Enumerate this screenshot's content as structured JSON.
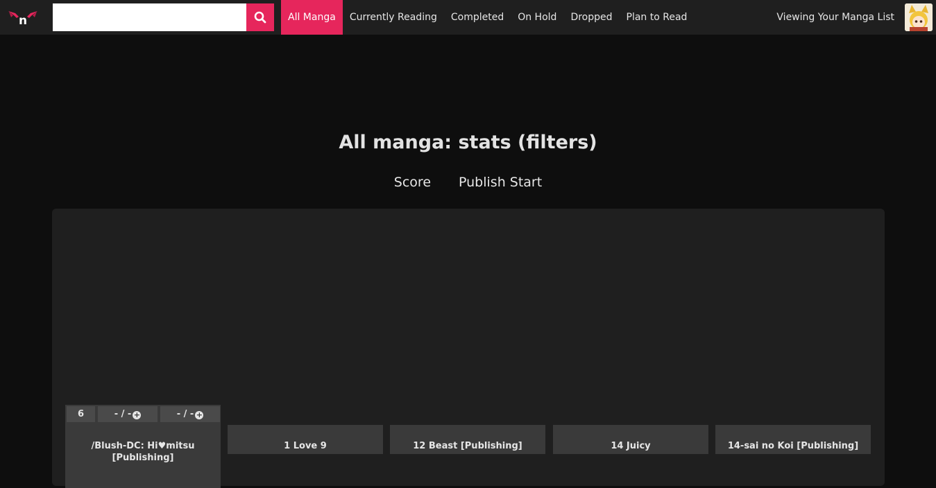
{
  "search": {
    "placeholder": "",
    "value": ""
  },
  "nav": {
    "items": [
      "All Manga",
      "Currently Reading",
      "Completed",
      "On Hold",
      "Dropped",
      "Plan to Read"
    ],
    "active": "All Manga"
  },
  "header": {
    "viewing_label": "Viewing Your Manga List"
  },
  "main": {
    "title": "All manga: stats (filters)",
    "tabs": [
      "Score",
      "Publish Start"
    ]
  },
  "cards": {
    "expanded": {
      "score": "6",
      "progress_a": "- / -",
      "progress_b": "- / -",
      "title": "/Blush-DC: Hi♥mitsu [Publishing]"
    },
    "items": [
      "1 Love 9",
      "12 Beast [Publishing]",
      "14 Juicy",
      "14-sai no Koi [Publishing]"
    ]
  },
  "colors": {
    "accent": "#e6265c",
    "background": "#0e0e0e",
    "panel": "#1f1f1f",
    "card": "#3a3a3a"
  }
}
